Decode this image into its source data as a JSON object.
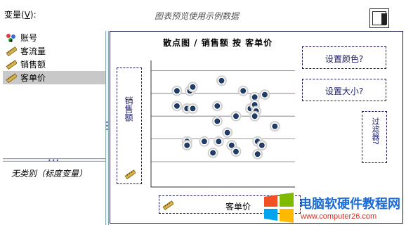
{
  "header": {
    "variables_label": "变量",
    "variables_hotkey": "V",
    "variables_suffix": "):",
    "preview_note": "图表预览使用示例数据"
  },
  "variables": [
    {
      "label": "账号",
      "icon": "nominal-variable-icon"
    },
    {
      "label": "客流量",
      "icon": "scale-ruler-icon"
    },
    {
      "label": "销售额",
      "icon": "scale-ruler-icon"
    },
    {
      "label": "客单价",
      "icon": "scale-ruler-icon",
      "selected": true
    }
  ],
  "categories_note": "无类别（标度变量）",
  "chart": {
    "title": "散点图 / 销售额 按 客单价",
    "y_axis_label": "销售额",
    "x_axis_label": "客单价",
    "set_color_label": "设置颜色?",
    "set_size_label": "设置大小?",
    "filter_label": "过滤器?"
  },
  "chart_data": {
    "type": "scatter",
    "title": "散点图 / 销售额 按 客单价",
    "xlabel": "客单价",
    "ylabel": "销售额",
    "points": [
      [
        1.8,
        7.6
      ],
      [
        2.7,
        7.6
      ],
      [
        2.9,
        7.9
      ],
      [
        4.9,
        8.4
      ],
      [
        6.4,
        7.6
      ],
      [
        7.2,
        7.1
      ],
      [
        7.9,
        7.3
      ],
      [
        1.8,
        6.4
      ],
      [
        2.5,
        6.2
      ],
      [
        2.9,
        6.2
      ],
      [
        4.6,
        6.4
      ],
      [
        6.9,
        6.2
      ],
      [
        7.2,
        6.5
      ],
      [
        7.3,
        6.0
      ],
      [
        4.6,
        5.2
      ],
      [
        5.9,
        5.6
      ],
      [
        7.2,
        5.6
      ],
      [
        8.6,
        4.8
      ],
      [
        5.3,
        4.3
      ],
      [
        2.5,
        3.6
      ],
      [
        2.5,
        3.3
      ],
      [
        3.7,
        3.6
      ],
      [
        4.7,
        3.6
      ],
      [
        5.6,
        3.3
      ],
      [
        5.9,
        2.8
      ],
      [
        7.4,
        3.6
      ],
      [
        7.7,
        3.3
      ],
      [
        4.3,
        2.7
      ],
      [
        7.4,
        2.6
      ]
    ],
    "grid": true,
    "marker_color": "#1f3d6b",
    "marker_ring_color": "#d0d0d0"
  }
}
